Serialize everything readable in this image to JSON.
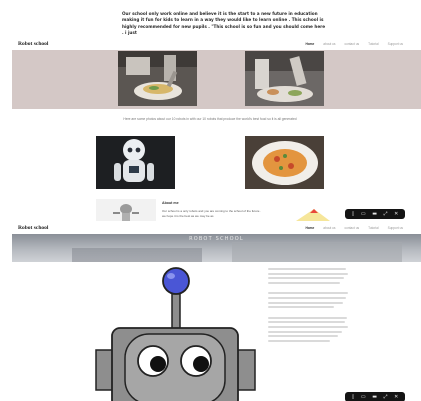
{
  "quote": "Our school only work online and believe it is the start to a new future in education making it fun for kids to learn in a way they would like to learn online . This school is highly recommended for new pupils . \"This school is so fun and you should come here . i just",
  "header": {
    "logo": "Robot school",
    "menu": [
      "Home",
      "about us",
      "contact us",
      "Tutorial",
      "Support us"
    ]
  },
  "caption": "Here are some photos about our 10 robots in with our 10 robots that produce the world's best food so it is all generated",
  "about": {
    "title": "About me",
    "text": "Our school is a only robots and you are coming to the school of the future . we hope it is the best as we may be as"
  },
  "overlay": {
    "icons": [
      "phone-icon",
      "tablet-icon",
      "desktop-icon",
      "expand-icon",
      "close-icon"
    ],
    "glyphs": [
      "▯",
      "▭",
      "▬",
      "⤢",
      "✕"
    ]
  },
  "banner": {
    "title": "ROBOT SCHOOL"
  },
  "colors": {
    "hero_bg": "#d4c8c6",
    "robot_body": "#8e8e8e",
    "robot_face": "#a6a6a6",
    "antenna_ball": "#4a56d6",
    "overlay_bg": "#141414"
  }
}
